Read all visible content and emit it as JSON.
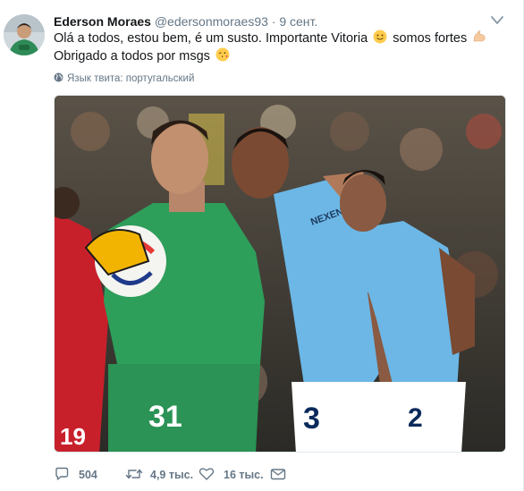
{
  "tweet": {
    "author_name": "Ederson Moraes",
    "author_handle": "@edersonmoraes93",
    "separator": "·",
    "timestamp": "9 сент.",
    "text_line1": "Olá a todos, estou bem, é um susto. Importante Vitoria",
    "text_line1_end": "somos fortes",
    "text_line2": "Obrigado a todos por msgs",
    "emojis": [
      "slightly-smiling-face-icon",
      "flexed-biceps-icon",
      "face-blowing-kiss-icon"
    ],
    "language_note": "Язык твита: португальский"
  },
  "media": {
    "shirt_numbers": [
      "31",
      "3",
      "2",
      "19"
    ],
    "sponsor_text": "NEXEN TIRE",
    "colors": {
      "keeper_green": "#2e9e5b",
      "city_blue": "#6cb7e6",
      "liverpool_red": "#c8202b"
    }
  },
  "actions": {
    "reply_count": "504",
    "retweet_count": "4,9 тыс.",
    "like_count": "16 тыс.",
    "icons": [
      "reply-icon",
      "retweet-icon",
      "like-icon",
      "direct-message-icon"
    ]
  },
  "colors": {
    "text": "#14171a",
    "muted": "#657786",
    "border": "#e6ecf0"
  }
}
